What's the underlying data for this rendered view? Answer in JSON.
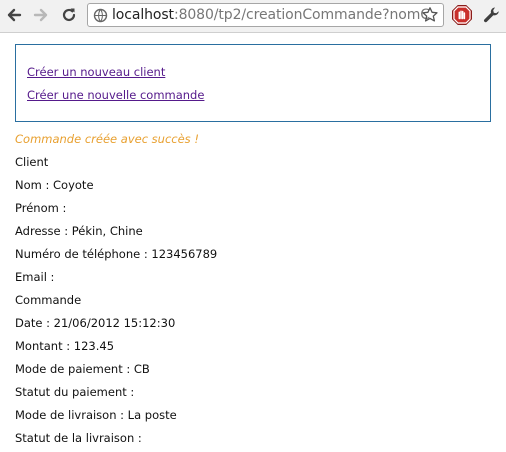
{
  "browser": {
    "url_host": "localhost",
    "url_rest": ":8080/tp2/creationCommande?nomC"
  },
  "menu": {
    "link_client": "Créer un nouveau client",
    "link_commande": "Créer une nouvelle commande"
  },
  "message": "Commande créée avec succès !",
  "details": [
    "Client",
    "Nom : Coyote",
    "Prénom :",
    "Adresse : Pékin, Chine",
    "Numéro de téléphone : 123456789",
    "Email :",
    "Commande",
    "Date : 21/06/2012 15:12:30",
    "Montant : 123.45",
    "Mode de paiement : CB",
    "Statut du paiement :",
    "Mode de livraison : La poste",
    "Statut de la livraison :"
  ]
}
